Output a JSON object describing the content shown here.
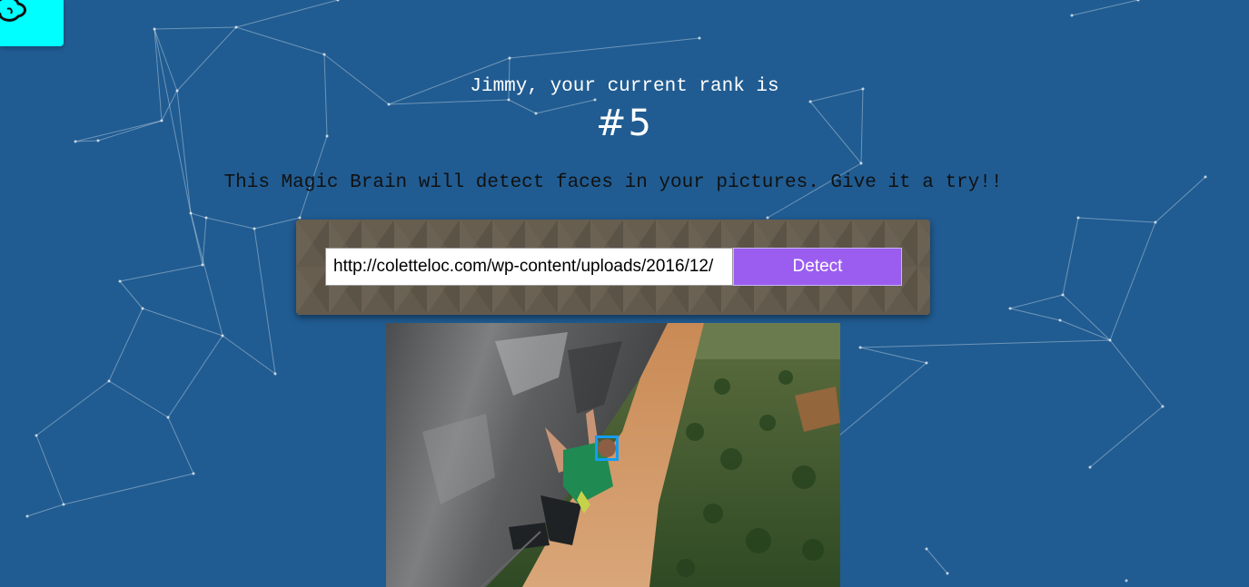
{
  "header": {
    "logo_icon": "brain-icon",
    "rank_text": "Jimmy, your current rank is",
    "rank_value": "#5"
  },
  "intro": {
    "text": "This Magic Brain will detect faces in your pictures. Give it a try!!"
  },
  "form": {
    "url_value": "http://coletteloc.com/wp-content/uploads/2016/12/",
    "detect_label": "Detect"
  },
  "result": {
    "photo": "rock-climber-photo",
    "faces_detected": 1
  },
  "colors": {
    "background": "#205c92",
    "logo_tile": "#00ffff",
    "button": "#9b5df0",
    "panel": "#625a4c",
    "face_box": "#149df2"
  }
}
